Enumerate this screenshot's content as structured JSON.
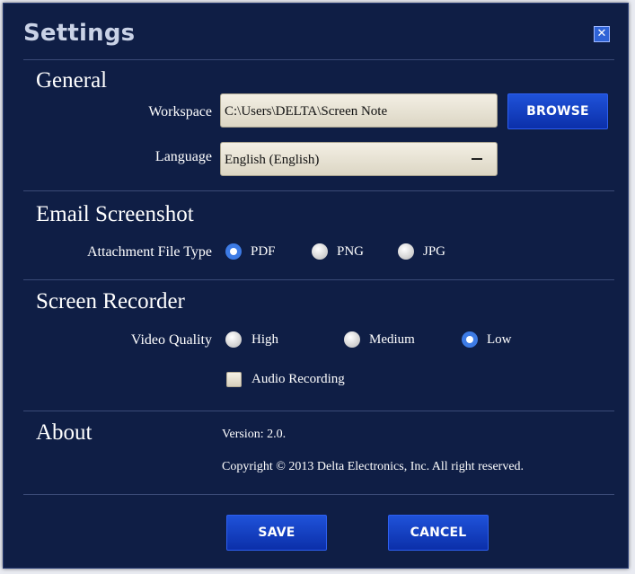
{
  "dialog": {
    "title": "Settings"
  },
  "general": {
    "section_title": "General",
    "workspace_label": "Workspace",
    "workspace_value": "C:\\Users\\DELTA\\Screen Note",
    "browse_label": "BROWSE",
    "language_label": "Language",
    "language_value": "English (English)"
  },
  "email": {
    "section_title": "Email Screenshot",
    "attachment_label": "Attachment File Type",
    "options": [
      "PDF",
      "PNG",
      "JPG"
    ],
    "selected": "PDF"
  },
  "recorder": {
    "section_title": "Screen Recorder",
    "quality_label": "Video Quality",
    "options": [
      "High",
      "Medium",
      "Low"
    ],
    "selected": "Low",
    "audio_label": "Audio Recording",
    "audio_checked": false
  },
  "about": {
    "section_title": "About",
    "version": "Version: 2.0.",
    "copyright": "Copyright © 2013 Delta Electronics, Inc. All right reserved."
  },
  "footer": {
    "save_label": "SAVE",
    "cancel_label": "CANCEL"
  },
  "colors": {
    "panel": "#0f1e45",
    "button": "#1a47c9",
    "radio_selected": "#3d7be5"
  },
  "icons": {
    "close": "close-icon",
    "dropdown": "chevron-down-icon"
  }
}
